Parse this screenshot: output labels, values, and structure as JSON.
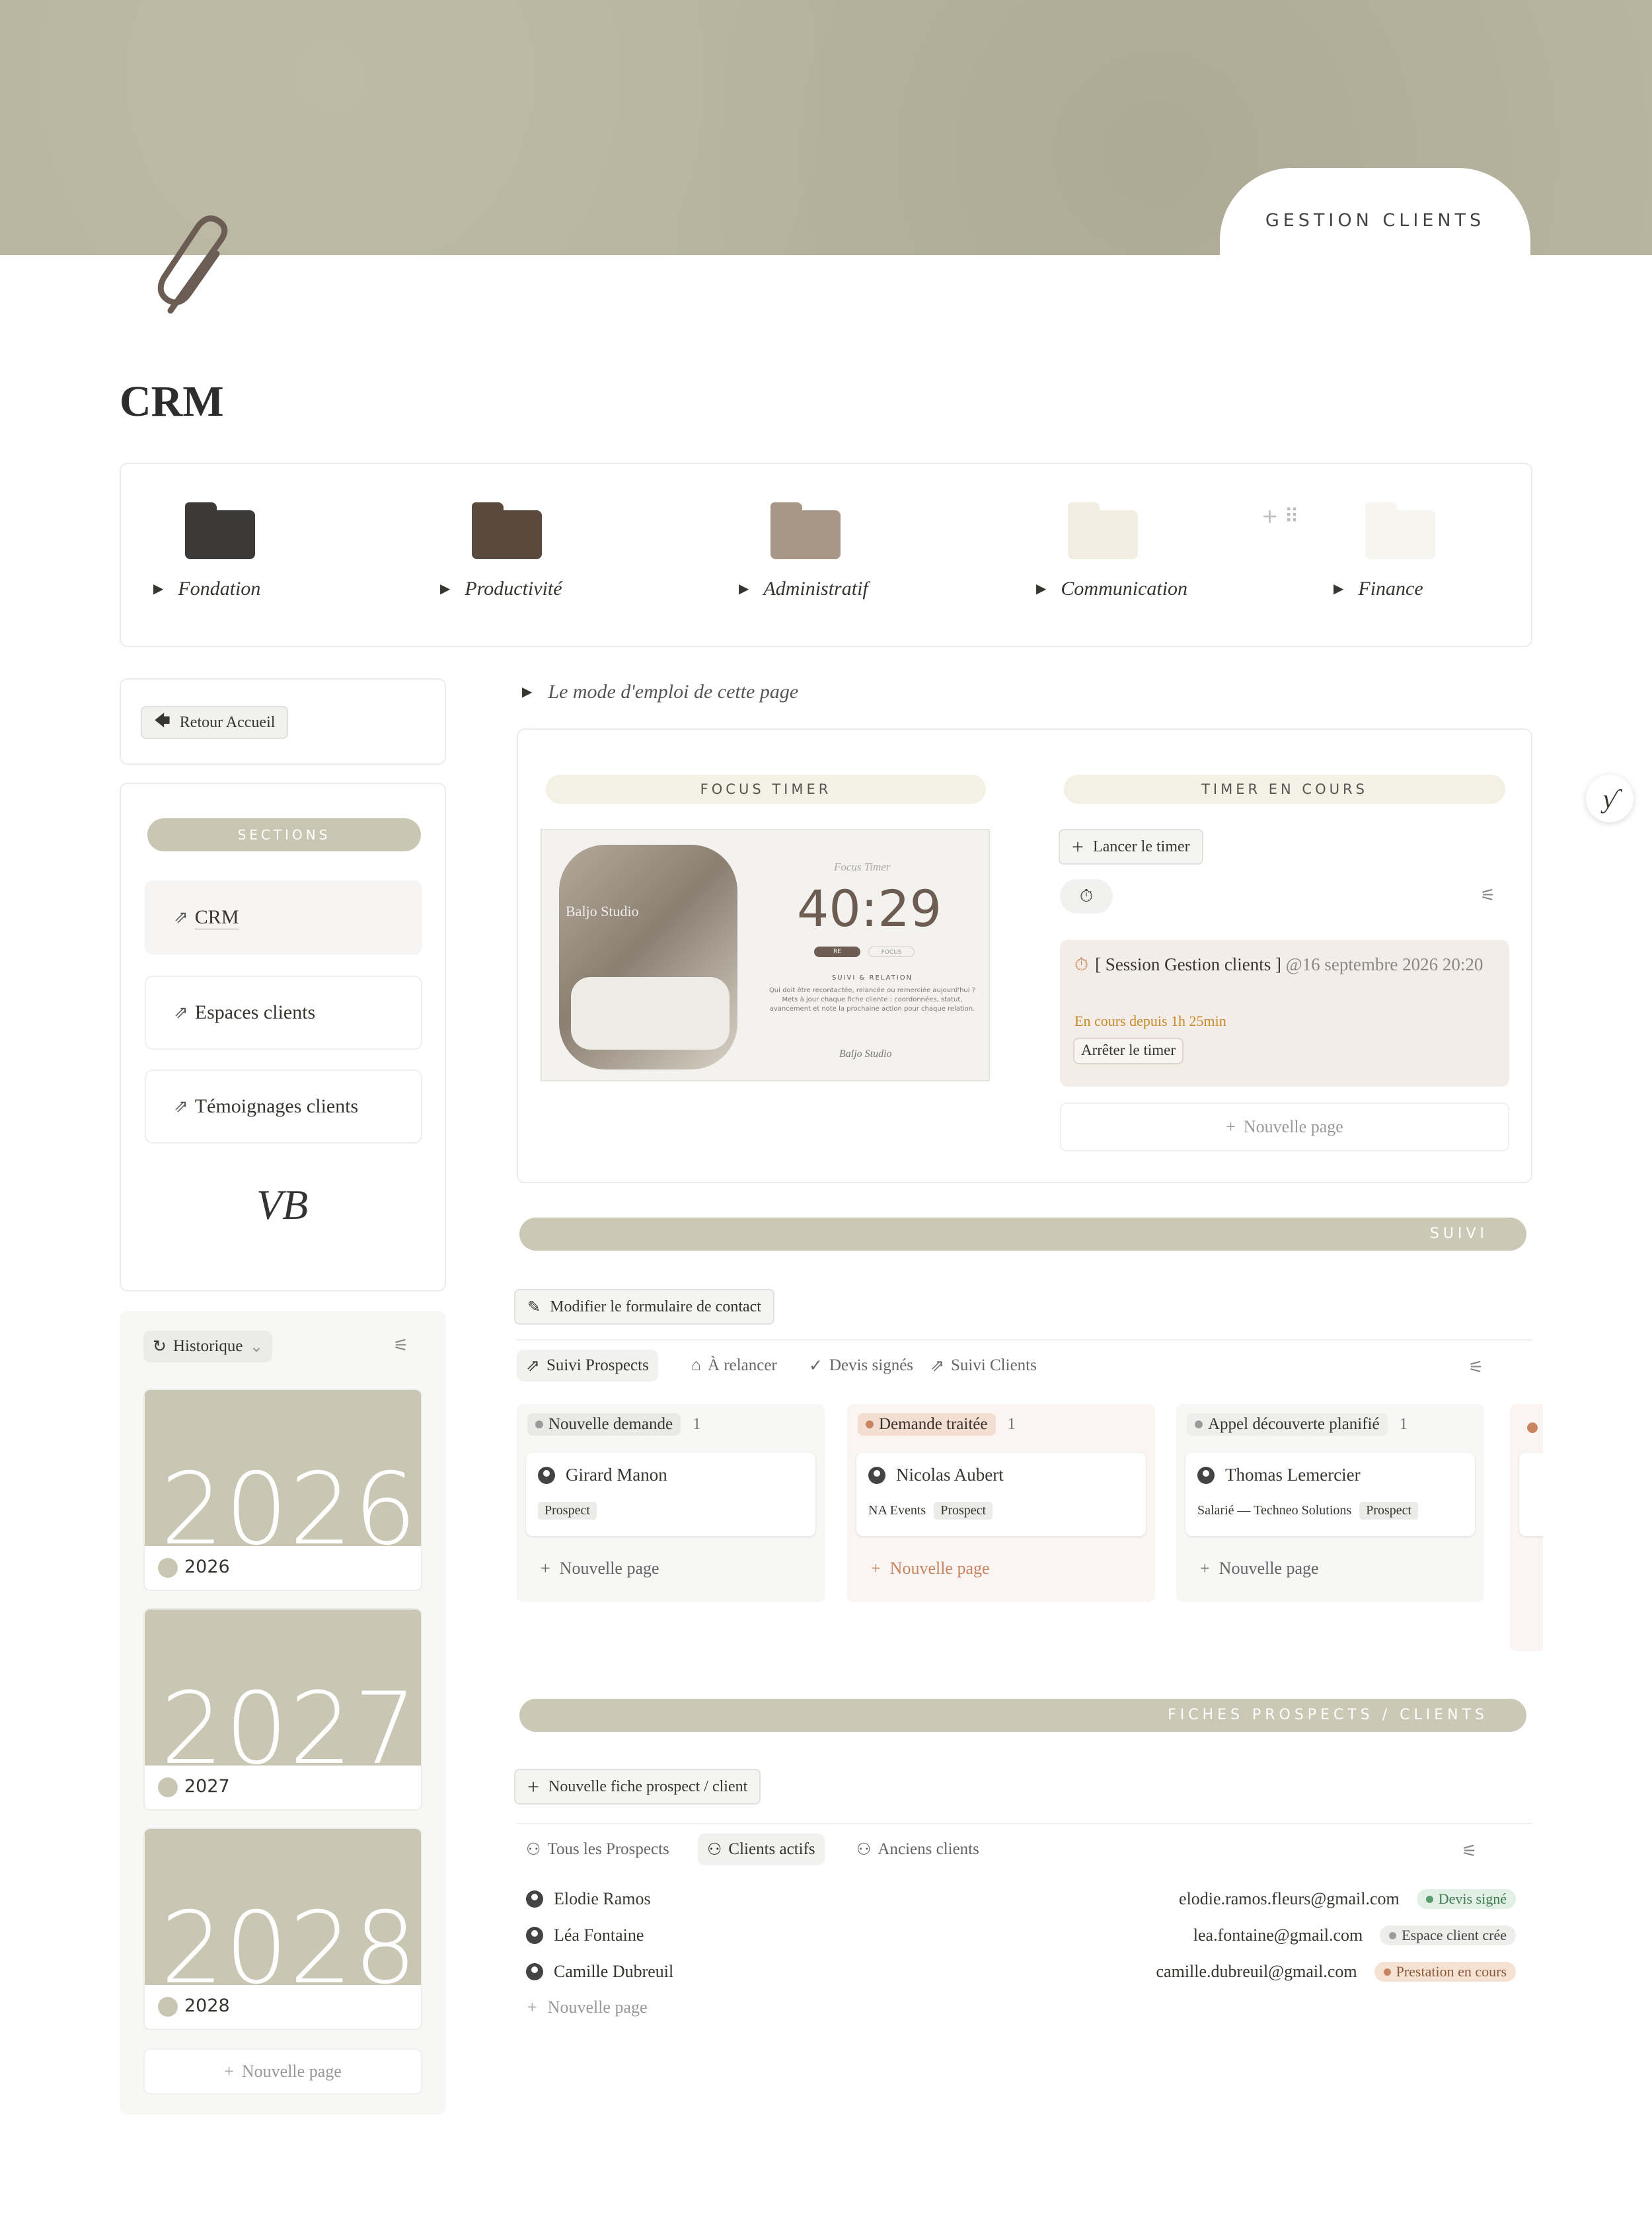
{
  "cover": {
    "tab_label": "GESTION CLIENTS",
    "color": "#b8b49e"
  },
  "page": {
    "title": "CRM"
  },
  "folders": [
    {
      "label": "Fondation",
      "color": "#3b3a38"
    },
    {
      "label": "Productivité",
      "color": "#5a4a3e"
    },
    {
      "label": "Administratif",
      "color": "#a89786"
    },
    {
      "label": "Communication",
      "color": "#f1ede0"
    },
    {
      "label": "Finance",
      "color": "#f6f5f0"
    }
  ],
  "folder_add_icons": "+ ⠿",
  "sidebar": {
    "back_button": "Retour Accueil",
    "sections_label": "SECTIONS",
    "items": [
      {
        "label": "CRM"
      },
      {
        "label": "Espaces clients"
      },
      {
        "label": "Témoignages clients"
      }
    ],
    "logo": "VB"
  },
  "history": {
    "label": "Historique",
    "years": [
      {
        "big": "2026",
        "label": "2026"
      },
      {
        "big": "2027",
        "label": "2027"
      },
      {
        "big": "2028",
        "label": "2028"
      }
    ],
    "new_page": "Nouvelle page"
  },
  "mode_emploi": "Le mode d'emploi de cette page",
  "timer": {
    "focus_label": "FOCUS TIMER",
    "current_label": "TIMER EN COURS",
    "image": {
      "photo_text": "Baljo Studio",
      "title": "Focus Timer",
      "clock": "40:29",
      "btn1": "RE",
      "btn2": "FOCUS",
      "subtitle": "SUIVI & RELATION",
      "text": "Qui doit être recontactée, relancée ou remerciée aujourd'hui ? Mets à jour chaque fiche cliente : coordonnées, statut, avancement et note la prochaine action pour chaque relation.",
      "signature": "Baljo Studio"
    },
    "launch_button": "Lancer le timer",
    "session": {
      "title": "[ Session Gestion clients ]",
      "date": "@16 septembre 2026 20:20",
      "since": "En cours depuis 1h 25min",
      "stop": "Arrêter le timer"
    },
    "new_page": "Nouvelle page"
  },
  "suivi": {
    "bar_label": "SUIVI",
    "modify_button": "Modifier le formulaire de contact",
    "tabs": [
      {
        "label": "Suivi Prospects",
        "icon": "link-icon",
        "active": true
      },
      {
        "label": "À relancer",
        "icon": "inbox-icon"
      },
      {
        "label": "Devis signés",
        "icon": "check-icon"
      },
      {
        "label": "Suivi Clients",
        "icon": "link-icon"
      }
    ],
    "columns": [
      {
        "status": "Nouvelle demande",
        "count": "1",
        "tag_bg": "#e9e9e7",
        "dot": "#9b9b9b",
        "bg": "#f7f7f5",
        "card": {
          "name": "Girard Manon",
          "company": "",
          "tag": "Prospect"
        },
        "new_page": "Nouvelle page",
        "new_color": "#666"
      },
      {
        "status": "Demande traitée",
        "count": "1",
        "tag_bg": "#f4ddd1",
        "dot": "#c8855f",
        "bg": "#faf5f2",
        "card": {
          "name": "Nicolas Aubert",
          "company": "NA Events",
          "tag": "Prospect"
        },
        "new_page": "Nouvelle page",
        "new_color": "#c8855f"
      },
      {
        "status": "Appel découverte planifié",
        "count": "1",
        "tag_bg": "#eeeeec",
        "dot": "#9b9b9b",
        "bg": "#f7f7f5",
        "card": {
          "name": "Thomas Lemercier",
          "company": "Salarié — Techneo Solutions",
          "tag": "Prospect"
        },
        "new_page": "Nouvelle page",
        "new_color": "#666"
      }
    ]
  },
  "fiches": {
    "bar_label": "FICHES PROSPECTS / CLIENTS",
    "new_button": "Nouvelle fiche prospect / client",
    "tabs": [
      {
        "label": "Tous les Prospects"
      },
      {
        "label": "Clients actifs",
        "active": true
      },
      {
        "label": "Anciens clients"
      }
    ],
    "rows": [
      {
        "name": "Elodie Ramos",
        "email": "elodie.ramos.fleurs@gmail.com",
        "status": "Devis signé",
        "bg": "#e1efe5",
        "dot": "#5a9b6e",
        "color": "#3e7a52"
      },
      {
        "name": "Léa Fontaine",
        "email": "lea.fontaine@gmail.com",
        "status": "Espace client crée",
        "bg": "#ededeb",
        "dot": "#9b9b9b",
        "color": "#444"
      },
      {
        "name": "Camille Dubreuil",
        "email": "camille.dubreuil@gmail.com",
        "status": "Prestation en cours",
        "bg": "#f6e2d3",
        "dot": "#c8855f",
        "color": "#8a5a3c"
      }
    ],
    "new_page": "Nouvelle page"
  },
  "side_widget": "ƴ"
}
